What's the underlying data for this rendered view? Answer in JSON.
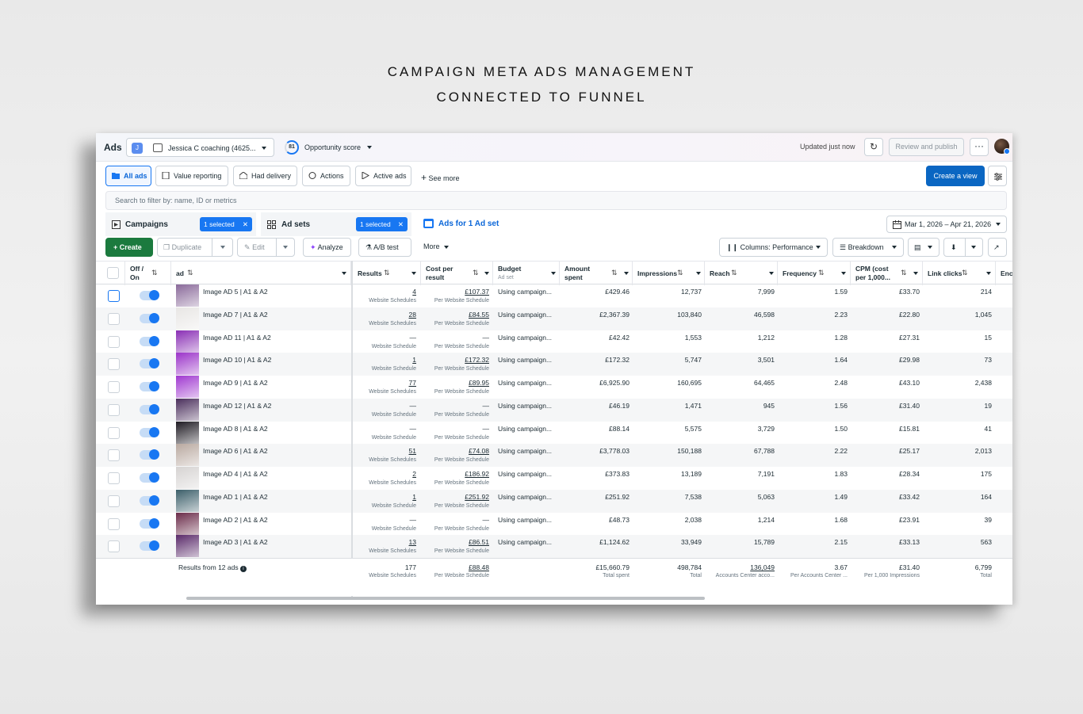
{
  "headline": {
    "line1": "CAMPAIGN META ADS MANAGEMENT",
    "line2": "CONNECTED TO FUNNEL"
  },
  "topbar": {
    "title": "Ads",
    "account_initial": "J",
    "account_name": "Jessica C coaching (4625...",
    "opportunity_score_value": "81",
    "opportunity_score_label": "Opportunity score",
    "updated": "Updated just now",
    "review_publish": "Review and publish",
    "more": "···"
  },
  "views": {
    "all_ads": "All ads",
    "value_reporting": "Value reporting",
    "had_delivery": "Had delivery",
    "actions": "Actions",
    "active_ads": "Active ads",
    "see_more": "See more",
    "create_view": "Create a view"
  },
  "search": {
    "placeholder": "Search to filter by: name, ID or metrics"
  },
  "levels": {
    "campaigns": "Campaigns",
    "campaigns_selected": "1 selected",
    "adsets": "Ad sets",
    "adsets_selected": "1 selected",
    "ads": "Ads for 1 Ad set",
    "date_range": "Mar 1, 2026 – Apr 21, 2026"
  },
  "actions": {
    "create": "Create",
    "duplicate": "Duplicate",
    "edit": "Edit",
    "analyze": "Analyze",
    "ab_test": "A/B test",
    "more": "More",
    "columns": "Columns: Performance",
    "breakdown": "Breakdown"
  },
  "columns": {
    "off_on": "Off /\nOn",
    "ad": "ad",
    "results": "Results",
    "cost_per_result": "Cost per\nresult",
    "budget": "Budget",
    "budget_sub": "Ad set",
    "amount_spent": "Amount\nspent",
    "impressions": "Impressions",
    "reach": "Reach",
    "frequency": "Frequency",
    "cpm": "CPM (cost\nper 1,000...",
    "link_clicks": "Link clicks",
    "ends": "Enc"
  },
  "rows": [
    {
      "name": "Image AD 5 | A1 & A2",
      "results": "4",
      "results_sub": "Website Schedules",
      "cpr": "£107.37",
      "cpr_sub": "Per Website Schedule",
      "budget": "Using campaign...",
      "spent": "£429.46",
      "impressions": "12,737",
      "reach": "7,999",
      "frequency": "1.59",
      "cpm": "£33.70",
      "clicks": "214",
      "thumb": "#8a6a9a"
    },
    {
      "name": "Image AD 7 | A1 & A2",
      "results": "28",
      "results_sub": "Website Schedules",
      "cpr": "£84.55",
      "cpr_sub": "Per Website Schedule",
      "budget": "Using campaign...",
      "spent": "£2,367.39",
      "impressions": "103,840",
      "reach": "46,598",
      "frequency": "2.23",
      "cpm": "£22.80",
      "clicks": "1,045",
      "thumb": "#e8e6e4"
    },
    {
      "name": "Image AD 11 | A1 & A2",
      "results": "—",
      "results_sub": "Website Schedule",
      "cpr": "—",
      "cpr_sub": "Per Website Schedule",
      "budget": "Using campaign...",
      "spent": "£42.42",
      "impressions": "1,553",
      "reach": "1,212",
      "frequency": "1.28",
      "cpm": "£27.31",
      "clicks": "15",
      "thumb": "#8a2fb5"
    },
    {
      "name": "Image AD 10 | A1 & A2",
      "results": "1",
      "results_sub": "Website Schedule",
      "cpr": "£172.32",
      "cpr_sub": "Per Website Schedule",
      "budget": "Using campaign...",
      "spent": "£172.32",
      "impressions": "5,747",
      "reach": "3,501",
      "frequency": "1.64",
      "cpm": "£29.98",
      "clicks": "73",
      "thumb": "#9b33c9"
    },
    {
      "name": "Image AD 9 | A1 & A2",
      "results": "77",
      "results_sub": "Website Schedules",
      "cpr": "£89.95",
      "cpr_sub": "Per Website Schedule",
      "budget": "Using campaign...",
      "spent": "£6,925.90",
      "impressions": "160,695",
      "reach": "64,465",
      "frequency": "2.48",
      "cpm": "£43.10",
      "clicks": "2,438",
      "thumb": "#a038d0"
    },
    {
      "name": "Image AD 12 | A1 & A2",
      "results": "—",
      "results_sub": "Website Schedule",
      "cpr": "—",
      "cpr_sub": "Per Website Schedule",
      "budget": "Using campaign...",
      "spent": "£46.19",
      "impressions": "1,471",
      "reach": "945",
      "frequency": "1.56",
      "cpm": "£31.40",
      "clicks": "19",
      "thumb": "#4a2e5c"
    },
    {
      "name": "Image AD 8 | A1 & A2",
      "results": "—",
      "results_sub": "Website Schedule",
      "cpr": "—",
      "cpr_sub": "Per Website Schedule",
      "budget": "Using campaign...",
      "spent": "£88.14",
      "impressions": "5,575",
      "reach": "3,729",
      "frequency": "1.50",
      "cpm": "£15.81",
      "clicks": "41",
      "thumb": "#1e1a22"
    },
    {
      "name": "Image AD 6 | A1 & A2",
      "results": "51",
      "results_sub": "Website Schedules",
      "cpr": "£74.08",
      "cpr_sub": "Per Website Schedule",
      "budget": "Using campaign...",
      "spent": "£3,778.03",
      "impressions": "150,188",
      "reach": "67,788",
      "frequency": "2.22",
      "cpm": "£25.17",
      "clicks": "2,013",
      "thumb": "#b9a9a0"
    },
    {
      "name": "Image AD 4 | A1 & A2",
      "results": "2",
      "results_sub": "Website Schedules",
      "cpr": "£186.92",
      "cpr_sub": "Per Website Schedule",
      "budget": "Using campaign...",
      "spent": "£373.83",
      "impressions": "13,189",
      "reach": "7,191",
      "frequency": "1.83",
      "cpm": "£28.34",
      "clicks": "175",
      "thumb": "#d6d3d2"
    },
    {
      "name": "Image AD 1 | A1 & A2",
      "results": "1",
      "results_sub": "Website Schedule",
      "cpr": "£251.92",
      "cpr_sub": "Per Website Schedule",
      "budget": "Using campaign...",
      "spent": "£251.92",
      "impressions": "7,538",
      "reach": "5,063",
      "frequency": "1.49",
      "cpm": "£33.42",
      "clicks": "164",
      "thumb": "#3c5f6a"
    },
    {
      "name": "Image AD 2 | A1 & A2",
      "results": "—",
      "results_sub": "Website Schedule",
      "cpr": "—",
      "cpr_sub": "Per Website Schedule",
      "budget": "Using campaign...",
      "spent": "£48.73",
      "impressions": "2,038",
      "reach": "1,214",
      "frequency": "1.68",
      "cpm": "£23.91",
      "clicks": "39",
      "thumb": "#6b2c4a"
    },
    {
      "name": "Image AD 3 | A1 & A2",
      "results": "13",
      "results_sub": "Website Schedules",
      "cpr": "£86.51",
      "cpr_sub": "Per Website Schedule",
      "budget": "Using campaign...",
      "spent": "£1,124.62",
      "impressions": "33,949",
      "reach": "15,789",
      "frequency": "2.15",
      "cpm": "£33.13",
      "clicks": "563",
      "thumb": "#5a2a6a"
    }
  ],
  "totals": {
    "label": "Results from 12 ads",
    "results": "177",
    "results_sub": "Website Schedules",
    "cpr": "£88.48",
    "cpr_sub": "Per Website Schedule",
    "spent": "£15,660.79",
    "spent_sub": "Total spent",
    "impressions": "498,784",
    "impressions_sub": "Total",
    "reach": "136,049",
    "reach_sub": "Accounts Center acco...",
    "frequency": "3.67",
    "frequency_sub": "Per Accounts Center ...",
    "cpm": "£31.40",
    "cpm_sub": "Per 1,000 Impressions",
    "clicks": "6,799",
    "clicks_sub": "Total"
  },
  "colors": {
    "accent": "#1877f2",
    "create_green": "#1b7a3e",
    "primary_blue": "#0a66c2"
  },
  "icons": [
    "refresh-icon",
    "more-icon",
    "folder-icon",
    "document-icon",
    "inbox-icon",
    "actions-icon",
    "play-icon",
    "plus-icon",
    "calendar-icon",
    "close-icon",
    "grid-icon",
    "flask-icon",
    "sparkle-icon",
    "pencil-icon",
    "copy-icon",
    "download-icon",
    "chart-icon",
    "settings-icon",
    "columns-icon",
    "breakdown-icon",
    "info-icon"
  ]
}
